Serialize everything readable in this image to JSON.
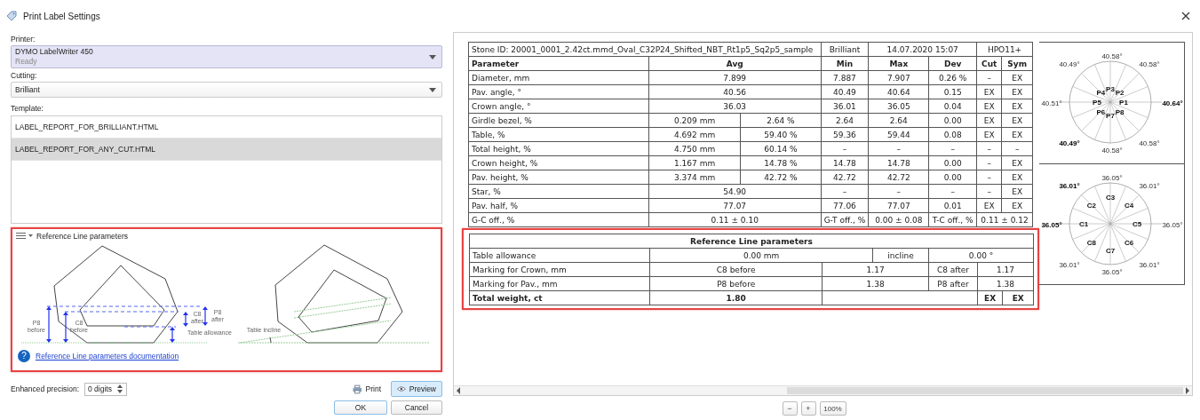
{
  "window": {
    "title": "Print Label Settings"
  },
  "printer": {
    "label": "Printer:",
    "name": "DYMO LabelWriter 450",
    "status": "Ready"
  },
  "cutting": {
    "label": "Cutting:",
    "value": "Brilliant"
  },
  "template": {
    "label": "Template:",
    "items": [
      {
        "text": "LABEL_REPORT_FOR_BRILLIANT.HTML",
        "selected": false
      },
      {
        "text": "LABEL_REPORT_FOR_ANY_CUT.HTML",
        "selected": true
      }
    ]
  },
  "reference_panel": {
    "title": "Reference Line parameters",
    "labels": [
      {
        "kind": "p8_before",
        "text": "P8 before"
      },
      {
        "kind": "c8_before",
        "text": "C8 before"
      },
      {
        "kind": "c8_after",
        "text": "C8 after"
      },
      {
        "kind": "p8_after",
        "text": "P8 after"
      },
      {
        "kind": "table_allowance",
        "text": "Table allowance"
      },
      {
        "kind": "table_incline",
        "text": "Table incline"
      }
    ],
    "help_icon": "?",
    "link": "Reference Line parameters documentation"
  },
  "precision": {
    "label": "Enhanced precision:",
    "value": "0 digits"
  },
  "buttons": [
    {
      "kind": "print",
      "label": "Print",
      "active": false
    },
    {
      "kind": "preview",
      "label": "Preview",
      "active": true
    },
    {
      "kind": "ok",
      "label": "OK",
      "active": false
    },
    {
      "kind": "cancel",
      "label": "Cancel",
      "active": false
    }
  ],
  "report": {
    "header": {
      "stone_id": "Stone ID: 20001_0001_2.42ct.mmd_Oval_C32P24_Shifted_NBT_Rt1p5_Sq2p5_sample",
      "cut": "Brilliant",
      "date": "14.07.2020 15:07",
      "device": "HPO11+"
    },
    "columns": [
      "Parameter",
      "Avg",
      "Min",
      "Max",
      "Dev",
      "Cut",
      "Sym"
    ],
    "rows": [
      {
        "kind": "single",
        "name": "Diameter, mm",
        "avg": "7.899",
        "min": "7.887",
        "max": "7.907",
        "dev": "0.26 %",
        "cut": "–",
        "sym": "EX"
      },
      {
        "kind": "single",
        "name": "Pav. angle, °",
        "avg": "40.56",
        "min": "40.49",
        "max": "40.64",
        "dev": "0.15",
        "cut": "EX",
        "sym": "EX"
      },
      {
        "kind": "single",
        "name": "Crown angle, °",
        "avg": "36.03",
        "min": "36.01",
        "max": "36.05",
        "dev": "0.04",
        "cut": "EX",
        "sym": "EX"
      },
      {
        "kind": "split",
        "name": "Girdle bezel, %",
        "avg_mm": "0.209 mm",
        "avg_pct": "2.64 %",
        "min": "2.64",
        "max": "2.64",
        "dev": "0.00",
        "cut": "EX",
        "sym": "EX"
      },
      {
        "kind": "split",
        "name": "Table, %",
        "avg_mm": "4.692 mm",
        "avg_pct": "59.40 %",
        "min": "59.36",
        "max": "59.44",
        "dev": "0.08",
        "cut": "EX",
        "sym": "EX"
      },
      {
        "kind": "split",
        "name": "Total height, %",
        "avg_mm": "4.750 mm",
        "avg_pct": "60.14 %",
        "min": "–",
        "max": "–",
        "dev": "–",
        "cut": "–",
        "sym": "–"
      },
      {
        "kind": "split",
        "name": "Crown height, %",
        "avg_mm": "1.167 mm",
        "avg_pct": "14.78 %",
        "min": "14.78",
        "max": "14.78",
        "dev": "0.00",
        "cut": "–",
        "sym": "EX"
      },
      {
        "kind": "split",
        "name": "Pav. height, %",
        "avg_mm": "3.374 mm",
        "avg_pct": "42.72 %",
        "min": "42.72",
        "max": "42.72",
        "dev": "0.00",
        "cut": "–",
        "sym": "EX"
      },
      {
        "kind": "single",
        "name": "Star, %",
        "avg": "54.90",
        "min": "–",
        "max": "–",
        "dev": "–",
        "cut": "–",
        "sym": "EX"
      },
      {
        "kind": "single",
        "name": "Pav. half, %",
        "avg": "77.07",
        "min": "77.06",
        "max": "77.07",
        "dev": "0.01",
        "cut": "EX",
        "sym": "EX"
      },
      {
        "kind": "offsets",
        "name": "G-C off., %",
        "avg": "0.11 ± 0.10",
        "gt_label": "G-T off., %",
        "gt": "0.00 ± 0.08",
        "tc_label": "T-C off., %",
        "tc": "0.11 ± 0.12"
      }
    ],
    "reference": {
      "title": "Reference Line parameters",
      "rows": [
        {
          "kind": "allowance",
          "label": "Table allowance",
          "value": "0.00 mm",
          "incline_label": "incline",
          "incline": "0.00 °"
        },
        {
          "kind": "marking",
          "label": "Marking for Crown, mm",
          "before_label": "C8 before",
          "before": "1.17",
          "after_label": "C8 after",
          "after": "1.17"
        },
        {
          "kind": "marking",
          "label": "Marking for Pav., mm",
          "before_label": "P8 before",
          "before": "1.38",
          "after_label": "P8 after",
          "after": "1.38"
        },
        {
          "kind": "total",
          "label": "Total weight, ct",
          "value": "1.80",
          "cut": "EX",
          "sym": "EX"
        }
      ]
    },
    "pavilion_diagram": {
      "angles": [
        {
          "text": "40.58°",
          "bold": false
        },
        {
          "text": "40.58°",
          "bold": false
        },
        {
          "text": "40.64°",
          "bold": true
        },
        {
          "text": "40.58°",
          "bold": false
        },
        {
          "text": "40.58°",
          "bold": false
        },
        {
          "text": "40.49°",
          "bold": true
        },
        {
          "text": "40.51°",
          "bold": false
        },
        {
          "text": "40.49°",
          "bold": false
        }
      ],
      "facets": [
        "P4",
        "P3",
        "P2",
        "P5",
        "P1",
        "P6",
        "P7",
        "P8"
      ]
    },
    "crown_diagram": {
      "angles": [
        {
          "text": "36.05°",
          "bold": false
        },
        {
          "text": "36.01°",
          "bold": false
        },
        {
          "text": "36.05°",
          "bold": false
        },
        {
          "text": "36.01°",
          "bold": false
        },
        {
          "text": "36.05°",
          "bold": false
        },
        {
          "text": "36.01°",
          "bold": false
        },
        {
          "text": "36.05°",
          "bold": true
        },
        {
          "text": "36.01°",
          "bold": true
        }
      ],
      "facets": [
        "C3",
        "C2",
        "C4",
        "C1",
        "C5",
        "C8",
        "C6",
        "C7"
      ]
    }
  },
  "zoom": {
    "minus_icon": "−",
    "plus_icon": "+",
    "reset": "100%"
  }
}
